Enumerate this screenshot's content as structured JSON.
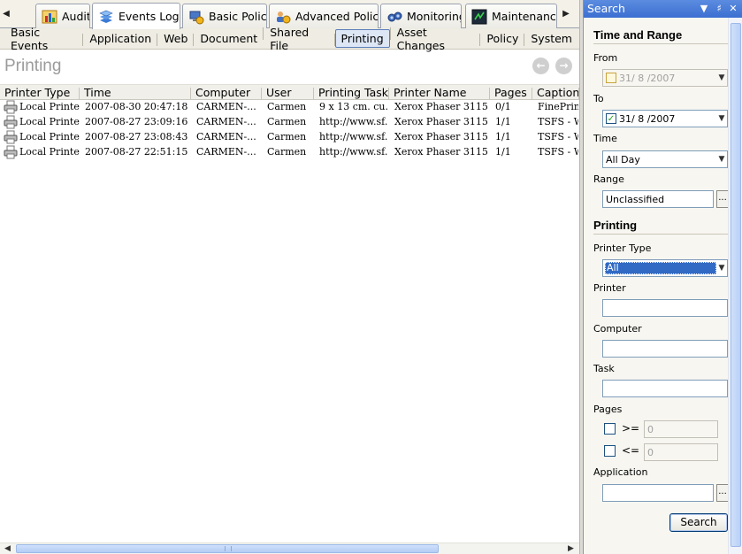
{
  "tabs": {
    "items": [
      {
        "label": "Audit"
      },
      {
        "label": "Events Log"
      },
      {
        "label": "Basic Policy"
      },
      {
        "label": "Advanced Policy"
      },
      {
        "label": "Monitoring"
      },
      {
        "label": "Maintenance"
      }
    ],
    "active": "Events Log"
  },
  "subtabs": {
    "items": [
      "Basic Events",
      "Application",
      "Web",
      "Document",
      "Shared File",
      "Printing",
      "Asset Changes",
      "Policy",
      "System"
    ],
    "active": "Printing"
  },
  "page": {
    "title": "Printing"
  },
  "grid": {
    "columns": [
      "Printer Type",
      "Time",
      "Computer",
      "User",
      "Printing Task",
      "Printer Name",
      "Pages",
      "Caption"
    ],
    "rows": [
      {
        "printer_type": "Local Printer",
        "time": "2007-08-30 20:47:18",
        "computer": "CARMEN-...",
        "user": "Carmen",
        "task": "9 x 13 cm. cu...",
        "printer_name": "Xerox Phaser 3115",
        "pages": "0/1",
        "caption": "FinePrint"
      },
      {
        "printer_type": "Local Printer",
        "time": "2007-08-27 23:09:16",
        "computer": "CARMEN-...",
        "user": "Carmen",
        "task": "http://www.sf...",
        "printer_name": "Xerox Phaser 3115",
        "pages": "1/1",
        "caption": "TSFS - W"
      },
      {
        "printer_type": "Local Printer",
        "time": "2007-08-27 23:08:43",
        "computer": "CARMEN-...",
        "user": "Carmen",
        "task": "http://www.sf...",
        "printer_name": "Xerox Phaser 3115",
        "pages": "1/1",
        "caption": "TSFS - W"
      },
      {
        "printer_type": "Local Printer",
        "time": "2007-08-27 22:51:15",
        "computer": "CARMEN-...",
        "user": "Carmen",
        "task": "http://www.sf...",
        "printer_name": "Xerox Phaser 3115",
        "pages": "1/1",
        "caption": "TSFS - W"
      }
    ]
  },
  "search": {
    "title": "Search",
    "time_section": "Time and Range",
    "from_label": "From",
    "from_value": "31/ 8 /2007",
    "to_label": "To",
    "to_value": "31/ 8 /2007",
    "time_label": "Time",
    "time_value": "All Day",
    "range_label": "Range",
    "range_value": "Unclassified",
    "printing_section": "Printing",
    "printer_type_label": "Printer Type",
    "printer_type_value": "All",
    "printer_label": "Printer",
    "printer_value": "",
    "computer_label": "Computer",
    "computer_value": "",
    "task_label": "Task",
    "task_value": "",
    "pages_label": "Pages",
    "pages_ge_op": ">=",
    "pages_ge_value": "0",
    "pages_le_op": "<=",
    "pages_le_value": "0",
    "application_label": "Application",
    "application_value": "",
    "ellipsis": "...",
    "button_label": "Search"
  },
  "colors": {
    "panel_title": "#3c6fd1",
    "selection": "#316ac5",
    "active_subtab": "#dde6f5"
  }
}
